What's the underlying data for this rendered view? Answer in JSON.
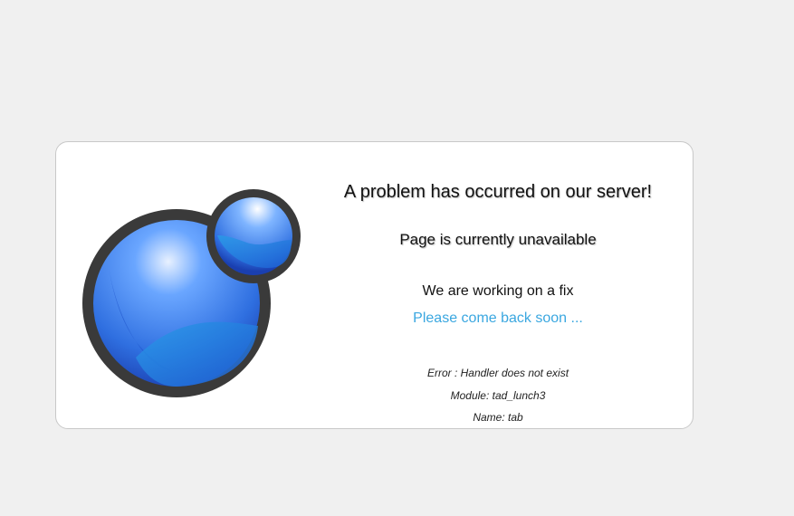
{
  "logo": {
    "icon": "xoops-bubble-logo-icon"
  },
  "messages": {
    "title": "A problem has occurred on our server!",
    "subtitle": "Page is currently unavailable",
    "working": "We are working on a fix",
    "come_back": "Please come back soon ..."
  },
  "error_details": {
    "error": "Error : Handler does not exist",
    "module": "Module: tad_lunch3",
    "name": "Name: tab"
  },
  "colors": {
    "background": "#f0f0f0",
    "card": "#ffffff",
    "link_blue": "#3aa7e0",
    "ring": "#3a3a3a"
  }
}
